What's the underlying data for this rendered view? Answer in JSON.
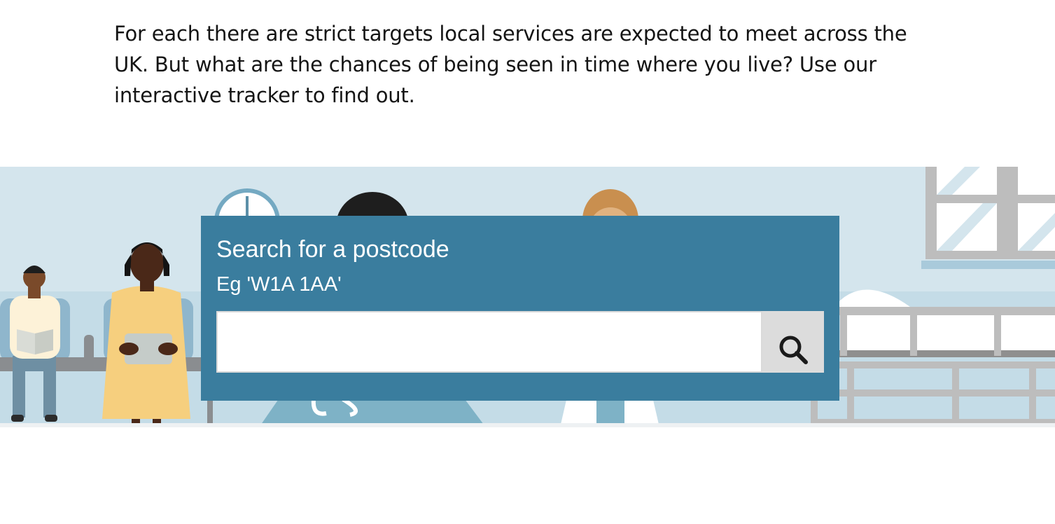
{
  "article": {
    "intro": "For each there are strict targets local services are expected to meet across the UK. But what are the chances of being seen in time where you live? Use our interactive tracker to find out."
  },
  "illustration": {
    "name": "hospital waiting room illustration"
  },
  "search": {
    "title": "Search for a postcode",
    "example": "Eg 'W1A 1AA'",
    "value": "",
    "placeholder": "",
    "button_icon": "search-icon"
  },
  "colors": {
    "panel": "#3a7d9e",
    "scene_background": "#d4e5ed",
    "button": "#dcdcdc"
  }
}
